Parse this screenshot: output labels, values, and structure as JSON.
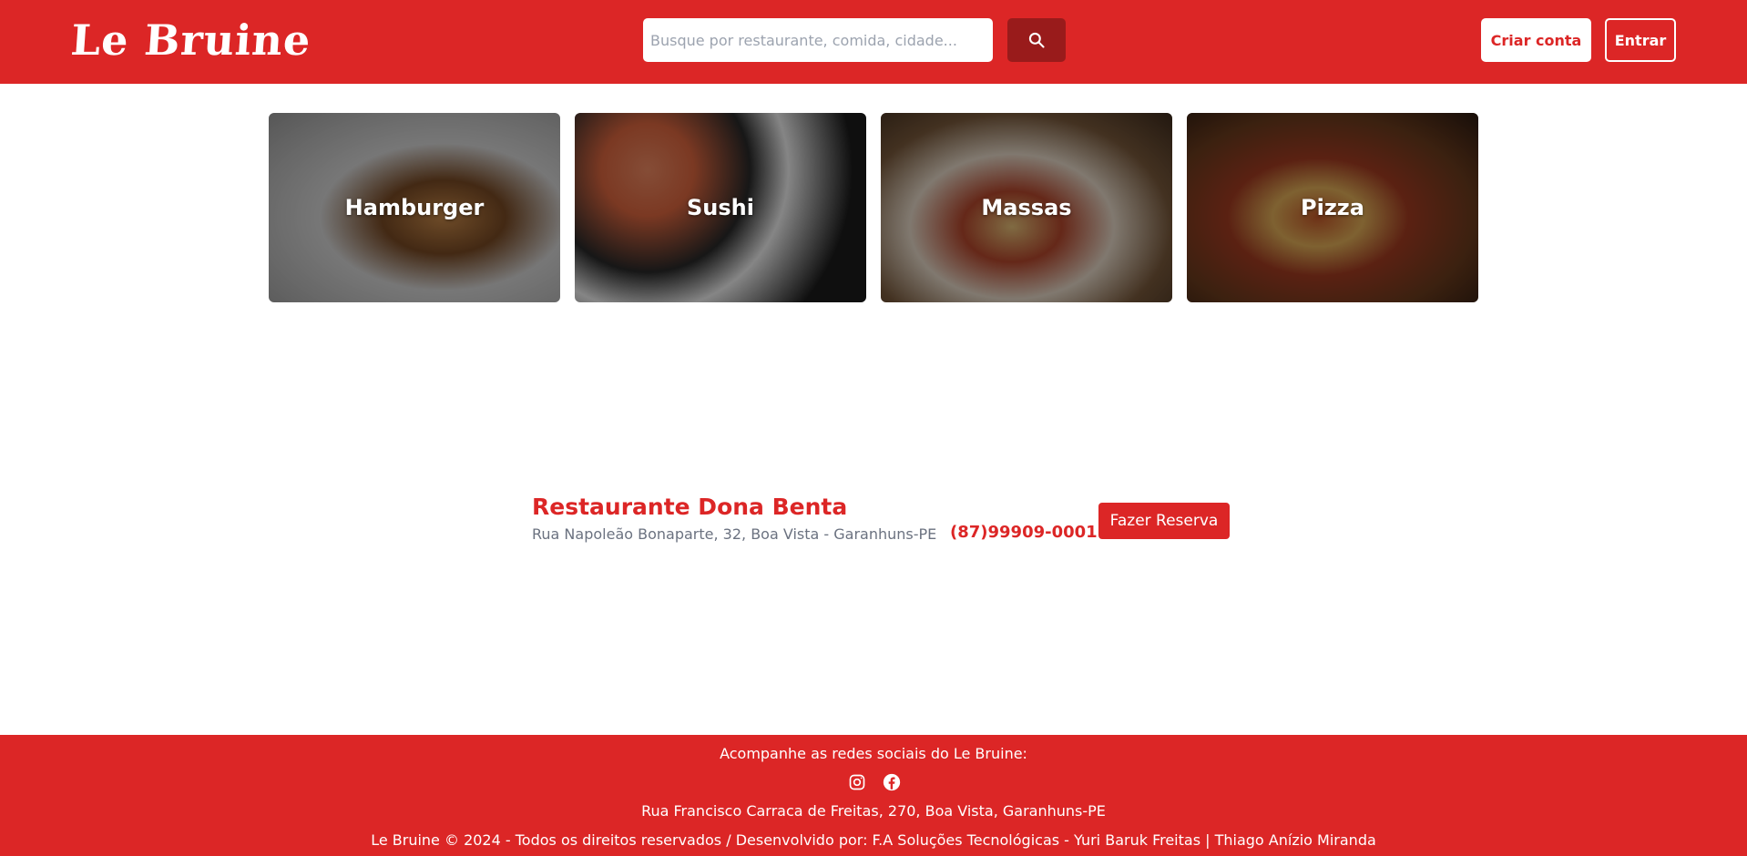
{
  "header": {
    "logo": "Le Bruine",
    "search": {
      "placeholder": "Busque por restaurante, comida, cidade..."
    },
    "create_account": "Criar conta",
    "login": "Entrar",
    "colors": {
      "primary": "#dc2626",
      "search_button": "#991b1b"
    }
  },
  "categories": [
    {
      "label": "Hamburger",
      "icon": "burger-image"
    },
    {
      "label": "Sushi",
      "icon": "sushi-image"
    },
    {
      "label": "Massas",
      "icon": "pasta-image"
    },
    {
      "label": "Pizza",
      "icon": "pizza-image"
    }
  ],
  "restaurant": {
    "name": "Restaurante Dona Benta",
    "address": "Rua Napoleão Bonaparte, 32, Boa Vista - Garanhuns-PE",
    "phone": "(87)99909-0001",
    "reserve_label": "Fazer Reserva"
  },
  "footer": {
    "social_text": "Acompanhe as redes sociais do Le Bruine:",
    "social_icons": [
      "instagram-icon",
      "facebook-icon"
    ],
    "address": "Rua Francisco Carraca de Freitas, 270, Boa Vista, Garanhuns-PE",
    "copyright": "Le Bruine © 2024 - Todos os direitos reservados / Desenvolvido por: F.A Soluções Tecnológicas - Yuri Baruk Freitas | Thiago Anízio Miranda"
  }
}
